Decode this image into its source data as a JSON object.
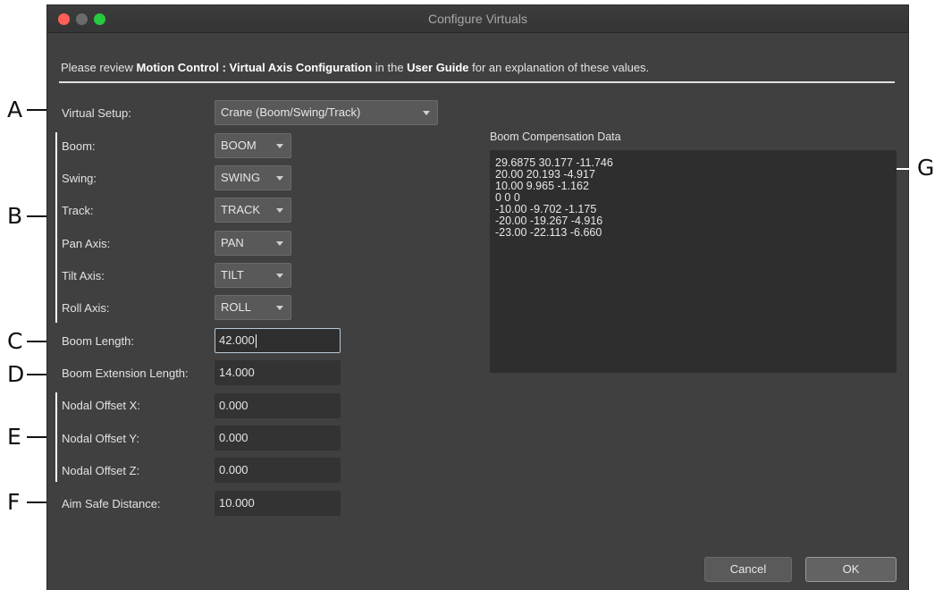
{
  "window": {
    "title": "Configure Virtuals"
  },
  "instructions": {
    "prefix": "Please review ",
    "bold1": "Motion Control : Virtual Axis Configuration",
    "middle": " in the ",
    "bold2": "User Guide",
    "suffix": " for an explanation of these values."
  },
  "form": {
    "virtual_setup": {
      "label": "Virtual Setup:",
      "value": "Crane (Boom/Swing/Track)"
    },
    "boom": {
      "label": "Boom:",
      "value": "BOOM"
    },
    "swing": {
      "label": "Swing:",
      "value": "SWING"
    },
    "track": {
      "label": "Track:",
      "value": "TRACK"
    },
    "pan": {
      "label": "Pan Axis:",
      "value": "PAN"
    },
    "tilt": {
      "label": "Tilt Axis:",
      "value": "TILT"
    },
    "roll": {
      "label": "Roll Axis:",
      "value": "ROLL"
    },
    "boom_length": {
      "label": "Boom Length:",
      "value": "42.000"
    },
    "boom_extension": {
      "label": "Boom Extension Length:",
      "value": "14.000"
    },
    "nodal_x": {
      "label": "Nodal Offset X:",
      "value": "0.000"
    },
    "nodal_y": {
      "label": "Nodal Offset Y:",
      "value": "0.000"
    },
    "nodal_z": {
      "label": "Nodal Offset Z:",
      "value": "0.000"
    },
    "aim_safe": {
      "label": "Aim Safe Distance:",
      "value": "10.000"
    }
  },
  "boom_compensation": {
    "label": "Boom Compensation Data",
    "lines": [
      "29.6875 30.177 -11.746",
      "20.00 20.193 -4.917",
      "10.00 9.965 -1.162",
      "0 0 0",
      "-10.00 -9.702 -1.175",
      "-20.00 -19.267 -4.916",
      "-23.00 -22.113 -6.660"
    ]
  },
  "buttons": {
    "cancel": "Cancel",
    "ok": "OK"
  },
  "callouts": {
    "a": "A",
    "b": "B",
    "c": "C",
    "d": "D",
    "e": "E",
    "f": "F",
    "g": "G"
  }
}
